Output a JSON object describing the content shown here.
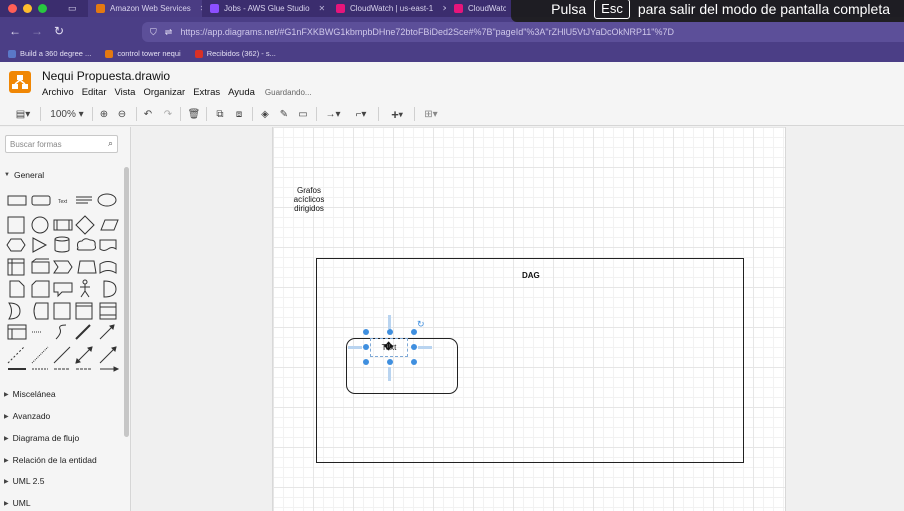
{
  "browser": {
    "tabs": [
      {
        "label": "Amazon Web Services",
        "color": "#e47911"
      },
      {
        "label": "Jobs - AWS Glue Studio",
        "color": "#8c4fff"
      },
      {
        "label": "CloudWatch | us-east-1",
        "color": "#e7157b"
      },
      {
        "label": "CloudWatch",
        "color": "#e7157b"
      }
    ],
    "url": "https://app.diagrams.net/#G1nFXKBWG1kbmpbDHne72btoFBiDed2Sce#%7B\"pageId\"%3A\"rZHlU5VtJYaDcOkNRP11\"%7D",
    "bookmarks": [
      "Build a 360 degree ...",
      "control tower nequi",
      "Recibidos (362) - s..."
    ],
    "fullscreen_notice": {
      "pre": "Pulsa",
      "key": "Esc",
      "post": "para salir del modo de pantalla completa"
    }
  },
  "app": {
    "title": "Nequi Propuesta.drawio",
    "menu": [
      "Archivo",
      "Editar",
      "Vista",
      "Organizar",
      "Extras",
      "Ayuda"
    ],
    "status": "Guardando...",
    "zoom": "100%"
  },
  "sidebar": {
    "search_placeholder": "Buscar formas",
    "general": "General",
    "sections": [
      "Miscelánea",
      "Avanzado",
      "Diagrama de flujo",
      "Relación de la entidad",
      "UML 2.5",
      "UML"
    ]
  },
  "diagram": {
    "grafos_label": "Grafos acíclicos dirigidos",
    "dag_label": "DAG",
    "text_element": "Text"
  }
}
